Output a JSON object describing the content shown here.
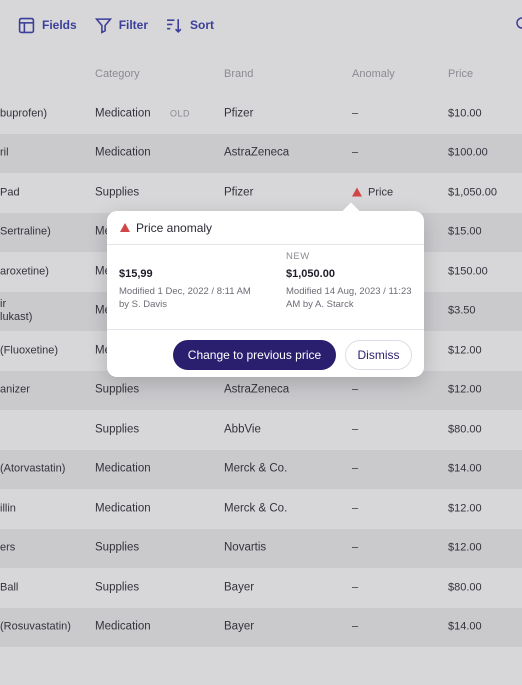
{
  "toolbar": {
    "fields_label": "Fields",
    "filter_label": "Filter",
    "sort_label": "Sort"
  },
  "columns": {
    "category": "Category",
    "brand": "Brand",
    "anomaly": "Anomaly",
    "price": "Price"
  },
  "rows": [
    {
      "name": "buprofen)",
      "category": "Medication",
      "badge": "OLD",
      "brand": "Pfizer",
      "anomaly": "–",
      "price": "$10.00"
    },
    {
      "name": "ril",
      "category": "Medication",
      "brand": "AstraZeneca",
      "anomaly": "–",
      "price": "$100.00"
    },
    {
      "name": "Pad",
      "category": "Supplies",
      "brand": "Pfizer",
      "anomaly": "Price",
      "price": "$1,050.00"
    },
    {
      "name": "Sertraline)",
      "category": "Me",
      "brand": "",
      "anomaly": "",
      "price": "$15.00"
    },
    {
      "name": "aroxetine)",
      "category": "Me",
      "brand": "",
      "anomaly": "",
      "price": "$150.00"
    },
    {
      "name": "ir\nlukast)",
      "category": "Me",
      "brand": "",
      "anomaly": "",
      "price": "$3.50"
    },
    {
      "name": "(Fluoxetine)",
      "category": "Me",
      "brand": "",
      "anomaly": "",
      "price": "$12.00"
    },
    {
      "name": "anizer",
      "category": "Supplies",
      "brand": "AstraZeneca",
      "anomaly": "–",
      "price": "$12.00"
    },
    {
      "name": "",
      "category": "Supplies",
      "brand": "AbbVie",
      "anomaly": "–",
      "price": "$80.00"
    },
    {
      "name": "(Atorvastatin)",
      "category": "Medication",
      "brand": "Merck & Co.",
      "anomaly": "–",
      "price": "$14.00"
    },
    {
      "name": "illin",
      "category": "Medication",
      "brand": "Merck & Co.",
      "anomaly": "–",
      "price": "$12.00"
    },
    {
      "name": "ers",
      "category": "Supplies",
      "brand": "Novartis",
      "anomaly": "–",
      "price": "$12.00"
    },
    {
      "name": "Ball",
      "category": "Supplies",
      "brand": "Bayer",
      "anomaly": "–",
      "price": "$80.00"
    },
    {
      "name": "(Rosuvastatin)",
      "category": "Medication",
      "brand": "Bayer",
      "anomaly": "–",
      "price": "$14.00"
    }
  ],
  "popup": {
    "title": "Price anomaly",
    "old": {
      "label": "",
      "price": "$15,99",
      "modified": "Modified 1 Dec, 2022 / 8:11 AM\nby S. Davis"
    },
    "new": {
      "label": "NEW",
      "price": "$1,050.00",
      "modified": "Modified 14 Aug, 2023 / 11:23\nAM by A. Starck"
    },
    "primary_button": "Change to previous price",
    "secondary_button": "Dismiss"
  },
  "colors": {
    "accent": "#2a1f6e",
    "warning": "#d04545",
    "toolbar_text": "#3c3f9a"
  }
}
